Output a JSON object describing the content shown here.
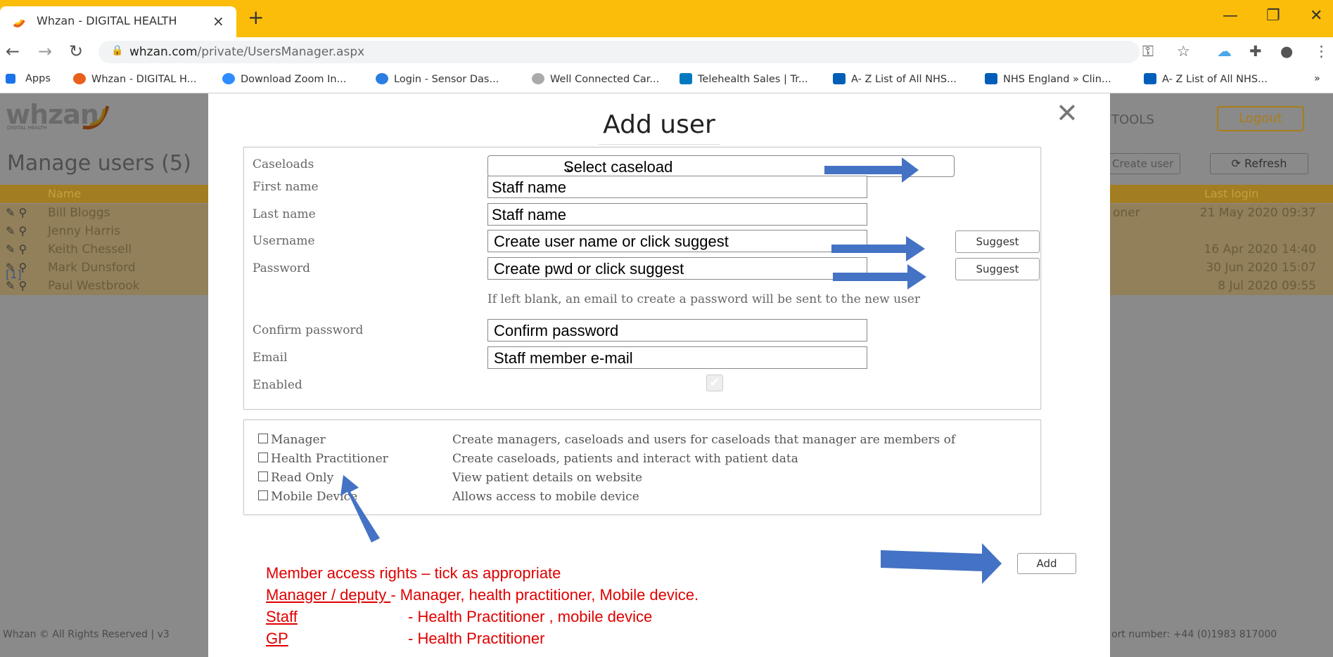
{
  "browser": {
    "tab_title": "Whzan - DIGITAL HEALTH",
    "tab_close": "×",
    "new_tab": "+",
    "url_domain": "whzan.com",
    "url_path": "/private/UsersManager.aspx",
    "bookmarks": [
      {
        "label": "Apps",
        "icon": "apps-grid-icon",
        "color": "#1a73e8"
      },
      {
        "label": "Whzan - DIGITAL H...",
        "icon": "whzan-favicon",
        "color": "#e8601c"
      },
      {
        "label": "Download Zoom In...",
        "icon": "zoom-icon",
        "color": "#2d8cff"
      },
      {
        "label": "Login - Sensor Das...",
        "icon": "sensor-icon",
        "color": "#2a7de1"
      },
      {
        "label": "Well Connected Car...",
        "icon": "globe-icon",
        "color": "#aaaaaa"
      },
      {
        "label": "Telehealth Sales | Tr...",
        "icon": "trello-icon",
        "color": "#0079bf"
      },
      {
        "label": "A- Z List of All NHS...",
        "icon": "nhs-icon",
        "color": "#005eb8"
      },
      {
        "label": "NHS England » Clin...",
        "icon": "nhs-icon",
        "color": "#005eb8"
      },
      {
        "label": "A- Z List of All NHS...",
        "icon": "nhs-icon",
        "color": "#005eb8"
      }
    ],
    "more": "»"
  },
  "page": {
    "logo": "whzan",
    "logo_sub": "DIGITAL HEALTH",
    "title": "Manage users (5)",
    "tools": "TOOLS",
    "logout": "Logout",
    "create_user": "Create user",
    "refresh": "Refresh",
    "col_name": "Name",
    "col_last_login": "Last login",
    "users": [
      {
        "name": "Bill Bloggs",
        "role": "oner",
        "last_login": "21 May 2020 09:37"
      },
      {
        "name": "Jenny Harris",
        "role": "",
        "last_login": ""
      },
      {
        "name": "Keith Chessell",
        "role": "",
        "last_login": "16 Apr 2020 14:40"
      },
      {
        "name": "Mark Dunsford",
        "role": "",
        "last_login": "30 Jun 2020 15:07"
      },
      {
        "name": "Paul Westbrook",
        "role": "",
        "last_login": "8 Jul 2020 09:55"
      }
    ],
    "pager": "[1]",
    "footer_left": "Whzan © All Rights Reserved | v3",
    "footer_right": "ort number: +44 (0)1983 817000"
  },
  "modal": {
    "title": "Add user",
    "close": "✕",
    "labels": {
      "caseloads": "Caseloads",
      "first_name": "First name",
      "last_name": "Last name",
      "username": "Username",
      "password": "Password",
      "confirm_password": "Confirm password",
      "email": "Email",
      "enabled": "Enabled"
    },
    "caseload_value": "Select caseload",
    "first_name_value": "Staff name",
    "last_name_value": "Staff name",
    "username_value": "Create user name or click suggest",
    "password_value": "Create pwd or click suggest",
    "suggest": "Suggest",
    "password_hint": "If left blank, an email to create a password will be sent to the new user",
    "confirm_password_value": "Confirm password",
    "email_value": "Staff member e-mail",
    "enabled": true,
    "roles": [
      {
        "label": "Manager",
        "desc": "Create managers, caseloads and users for caseloads that manager are members of"
      },
      {
        "label": "Health Practitioner",
        "desc": "Create caseloads, patients and interact with patient data"
      },
      {
        "label": "Read Only",
        "desc": "View patient details on website"
      },
      {
        "label": "Mobile Device",
        "desc": "Allows access to mobile device"
      }
    ],
    "add": "Add"
  },
  "annotations": {
    "heading": "Member access rights – tick as appropriate",
    "lines": [
      {
        "who": "Manager / deputy ",
        "what": "- Manager, health practitioner, Mobile device."
      },
      {
        "who": "Staff",
        "what": "- Health Practitioner , mobile device"
      },
      {
        "who": "GP",
        "what": "- Health Practitioner"
      }
    ],
    "arrow_color": "#4472c4",
    "text_color": "#e00000"
  }
}
